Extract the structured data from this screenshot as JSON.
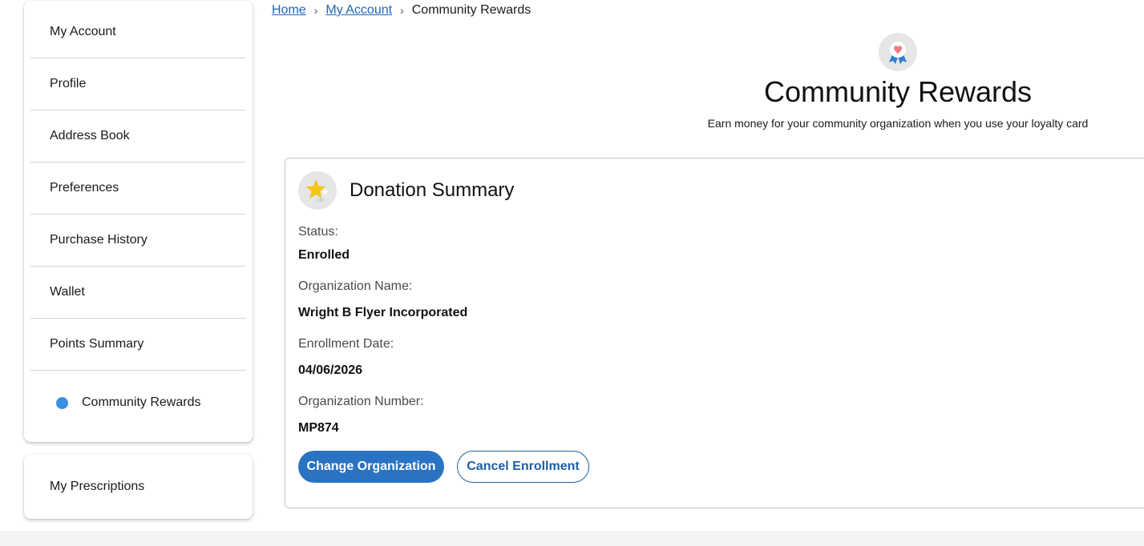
{
  "sidebar": {
    "items": [
      {
        "label": "My Account"
      },
      {
        "label": "Profile"
      },
      {
        "label": "Address Book"
      },
      {
        "label": "Preferences"
      },
      {
        "label": "Purchase History"
      },
      {
        "label": "Wallet"
      },
      {
        "label": "Points Summary"
      },
      {
        "label": "Community Rewards",
        "active": true
      }
    ],
    "secondary": {
      "label": "My Prescriptions"
    }
  },
  "breadcrumb": {
    "home": "Home",
    "account": "My Account",
    "current": "Community Rewards",
    "separator": "›"
  },
  "header": {
    "title": "Community Rewards",
    "subtitle": "Earn money for your community organization when you use your loyalty card",
    "icon": "award-ribbon-heart-icon"
  },
  "card": {
    "icon": "star-icon",
    "title": "Donation Summary",
    "fields": [
      {
        "label": "Status:",
        "value": "Enrolled"
      },
      {
        "label": "Organization Name:",
        "value": "Wright B Flyer Incorporated"
      },
      {
        "label": "Enrollment Date:",
        "value": "04/06/2026"
      },
      {
        "label": "Organization Number:",
        "value": "MP874"
      }
    ],
    "buttons": {
      "change": "Change Organization",
      "cancel": "Cancel Enrollment"
    }
  },
  "colors": {
    "accent": "#2a73c2",
    "active_dot": "#3b8fe0",
    "link": "#1f66b8"
  }
}
